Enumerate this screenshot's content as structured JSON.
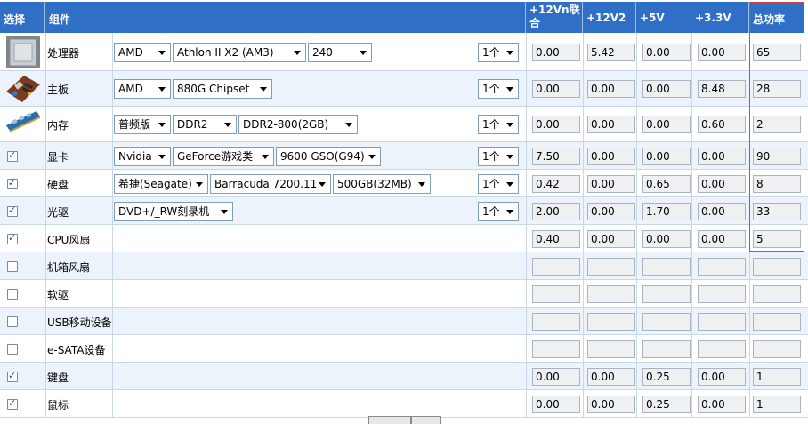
{
  "headers": [
    {
      "id": "select",
      "label": "选择"
    },
    {
      "id": "component",
      "label": "组件"
    },
    {
      "id": "v12vn",
      "label": "+12Vn联合"
    },
    {
      "id": "v12v2",
      "label": "+12V2"
    },
    {
      "id": "v5",
      "label": "+5V"
    },
    {
      "id": "v33",
      "label": "+3.3V"
    },
    {
      "id": "total",
      "label": "总功率"
    }
  ],
  "rows": [
    {
      "name": "处理器",
      "icon": "cpu-icon",
      "checkbox": null,
      "selects": [
        "AMD",
        "Athlon II X2 (AM3)",
        "240"
      ],
      "qty": "1个",
      "values": [
        "0.00",
        "5.42",
        "0.00",
        "0.00",
        "65"
      ]
    },
    {
      "name": "主板",
      "icon": "motherboard-icon",
      "checkbox": null,
      "selects": [
        "AMD",
        "880G Chipset"
      ],
      "qty": "1个",
      "values": [
        "0.00",
        "0.00",
        "0.00",
        "8.48",
        "28"
      ]
    },
    {
      "name": "内存",
      "icon": "memory-icon",
      "checkbox": null,
      "selects": [
        "普频版",
        "DDR2",
        "DDR2-800(2GB)"
      ],
      "qty": "1个",
      "values": [
        "0.00",
        "0.00",
        "0.00",
        "0.60",
        "2"
      ]
    },
    {
      "name": "显卡",
      "icon": null,
      "checkbox": true,
      "selects": [
        "Nvidia",
        "GeForce游戏类",
        "9600 GSO(G94)"
      ],
      "qty": "1个",
      "values": [
        "7.50",
        "0.00",
        "0.00",
        "0.00",
        "90"
      ]
    },
    {
      "name": "硬盘",
      "icon": null,
      "checkbox": true,
      "selects": [
        "希捷(Seagate)",
        "Barracuda 7200.11",
        "500GB(32MB)"
      ],
      "qty": "1个",
      "values": [
        "0.42",
        "0.00",
        "0.65",
        "0.00",
        "8"
      ]
    },
    {
      "name": "光驱",
      "icon": null,
      "checkbox": true,
      "selects": [
        "DVD+/_RW刻录机"
      ],
      "qty": "1个",
      "values": [
        "2.00",
        "0.00",
        "1.70",
        "0.00",
        "33"
      ]
    },
    {
      "name": "CPU风扇",
      "icon": null,
      "checkbox": true,
      "selects": [],
      "qty": null,
      "values": [
        "0.40",
        "0.00",
        "0.00",
        "0.00",
        "5"
      ]
    },
    {
      "name": "机箱风扇",
      "icon": null,
      "checkbox": false,
      "selects": [],
      "qty": null,
      "values": [
        "",
        "",
        "",
        "",
        ""
      ]
    },
    {
      "name": "软驱",
      "icon": null,
      "checkbox": false,
      "selects": [],
      "qty": null,
      "values": [
        "",
        "",
        "",
        "",
        ""
      ]
    },
    {
      "name": "USB移动设备",
      "icon": null,
      "checkbox": false,
      "selects": [],
      "qty": null,
      "values": [
        "",
        "",
        "",
        "",
        ""
      ]
    },
    {
      "name": "e-SATA设备",
      "icon": null,
      "checkbox": false,
      "selects": [],
      "qty": null,
      "values": [
        "",
        "",
        "",
        "",
        ""
      ]
    },
    {
      "name": "键盘",
      "icon": null,
      "checkbox": true,
      "selects": [],
      "qty": null,
      "values": [
        "0.00",
        "0.00",
        "0.25",
        "0.00",
        "1"
      ]
    },
    {
      "name": "鼠标",
      "icon": null,
      "checkbox": true,
      "selects": [],
      "qty": null,
      "values": [
        "0.00",
        "0.00",
        "0.25",
        "0.00",
        "1"
      ]
    }
  ],
  "colors": {
    "header_bg": "#2f6fc6",
    "row_alt": "#edf3fb",
    "highlight": "#e04040"
  }
}
